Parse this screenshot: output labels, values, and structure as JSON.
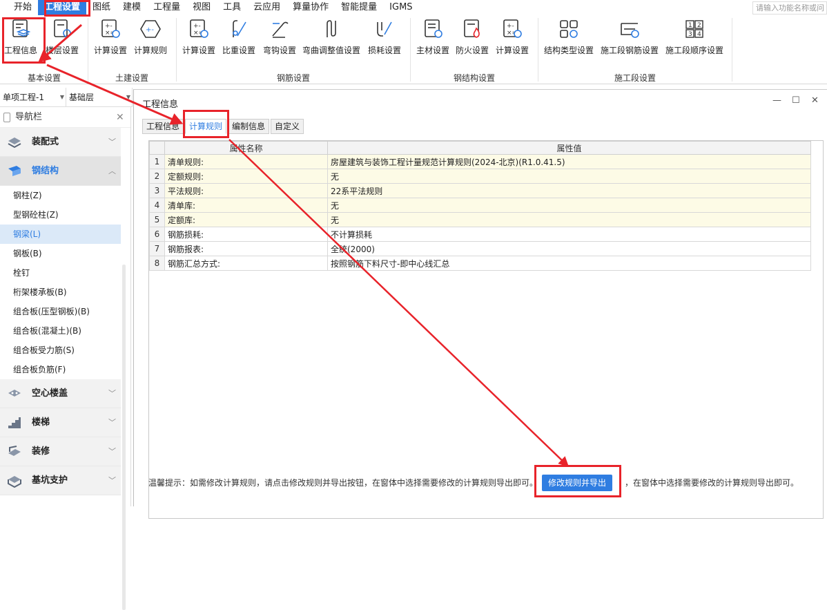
{
  "menu": {
    "items": [
      "开始",
      "工程设置",
      "图纸",
      "建模",
      "工程量",
      "视图",
      "工具",
      "云应用",
      "算量协作",
      "智能提量",
      "IGMS"
    ],
    "search_placeholder": "请输入功能名称或问"
  },
  "ribbon": {
    "buttons": [
      "工程信息",
      "楼层设置",
      "计算设置",
      "计算规则",
      "计算设置",
      "比重设置",
      "弯钩设置",
      "弯曲调整值设置",
      "损耗设置",
      "主材设置",
      "防火设置",
      "计算设置",
      "结构类型设置",
      "施工段钢筋设置",
      "施工段顺序设置"
    ],
    "groups": [
      "基本设置",
      "土建设置",
      "钢筋设置",
      "钢结构设置",
      "施工段设置"
    ]
  },
  "toolbar2": {
    "project": "单项工程-1",
    "floor": "基础层"
  },
  "nav": {
    "title": "导航栏",
    "categories": [
      "装配式",
      "钢结构",
      "空心楼盖",
      "楼梯",
      "装修",
      "基坑支护"
    ],
    "items": [
      "钢柱(Z)",
      "型钢砼柱(Z)",
      "钢梁(L)",
      "钢板(B)",
      "栓钉",
      "桁架楼承板(B)",
      "组合板(压型钢板)(B)",
      "组合板(混凝土)(B)",
      "组合板受力筋(S)",
      "组合板负筋(F)"
    ]
  },
  "dialog": {
    "title": "工程信息",
    "tabs": [
      "工程信息",
      "计算规则",
      "编制信息",
      "自定义"
    ],
    "columns": [
      "属性名称",
      "属性值"
    ],
    "rows": [
      {
        "num": "1",
        "name": "清单规则:",
        "value": "房屋建筑与装饰工程计量规范计算规则(2024-北京)(R1.0.41.5)"
      },
      {
        "num": "2",
        "name": "定额规则:",
        "value": "无"
      },
      {
        "num": "3",
        "name": "平法规则:",
        "value": "22系平法规则"
      },
      {
        "num": "4",
        "name": "清单库:",
        "value": "无"
      },
      {
        "num": "5",
        "name": "定额库:",
        "value": "无"
      },
      {
        "num": "6",
        "name": "钢筋损耗:",
        "value": "不计算损耗"
      },
      {
        "num": "7",
        "name": "钢筋报表:",
        "value": "全统(2000)"
      },
      {
        "num": "8",
        "name": "钢筋汇总方式:",
        "value": "按照钢筋下料尺寸-即中心线汇总"
      }
    ],
    "hint": "温馨提示：如需修改计算规则，请点击修改规则并导出按钮，在窗体中选择需要修改的计算规则导出即可。",
    "button": "修改规则并导出",
    "hint_tail": "，在窗体中选择需要修改的计算规则导出即可。"
  },
  "colors": {
    "accent": "#2f7de1",
    "annotation": "#e8232a"
  }
}
